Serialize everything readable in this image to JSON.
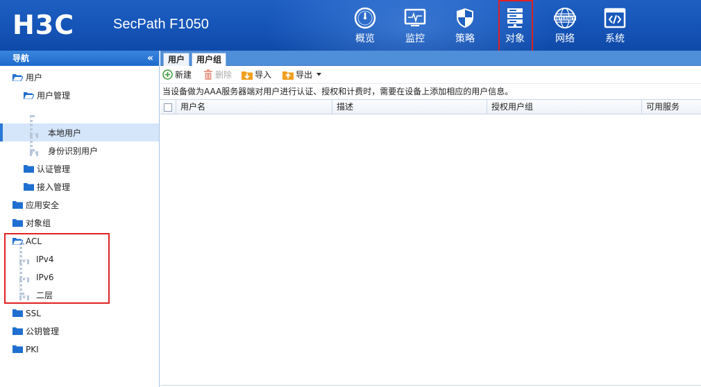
{
  "header": {
    "logo": "H3C",
    "product": "SecPath F1050",
    "nav": [
      {
        "label": "概览",
        "icon": "gauge-icon"
      },
      {
        "label": "监控",
        "icon": "monitor-icon"
      },
      {
        "label": "策略",
        "icon": "shield-icon"
      },
      {
        "label": "对象",
        "icon": "server-icon",
        "active": true
      },
      {
        "label": "网络",
        "icon": "internet-globe-icon"
      },
      {
        "label": "系统",
        "icon": "code-window-icon"
      }
    ],
    "globe_text": "INTERNET"
  },
  "sidebar": {
    "title": "导航",
    "collapse_glyph": "«",
    "tree": {
      "users": "用户",
      "user_mgmt": "用户管理",
      "local_user": "本地用户",
      "identity_user": "身份识别用户",
      "auth_mgmt": "认证管理",
      "access_mgmt": "接入管理",
      "app_security": "应用安全",
      "object_group": "对象组",
      "acl": "ACL",
      "ipv4": "IPv4",
      "ipv6": "IPv6",
      "layer2": "二层",
      "ssl": "SSL",
      "pki_mgmt": "公钥管理",
      "pki": "PKI"
    }
  },
  "main": {
    "tabs": [
      {
        "label": "用户"
      },
      {
        "label": "用户组"
      }
    ],
    "toolbar": {
      "new": "新建",
      "delete": "删除",
      "import": "导入",
      "export": "导出"
    },
    "info": "当设备做为AAA服务器端对用户进行认证、授权和计费时，需要在设备上添加相应的用户信息。",
    "columns": [
      "用户名",
      "描述",
      "授权用户组",
      "可用服务"
    ]
  },
  "colors": {
    "header_bg": "#1554b7",
    "highlight": "#e02020",
    "selected_row": "#d5e6fa",
    "folder": "#1f6fd0"
  }
}
